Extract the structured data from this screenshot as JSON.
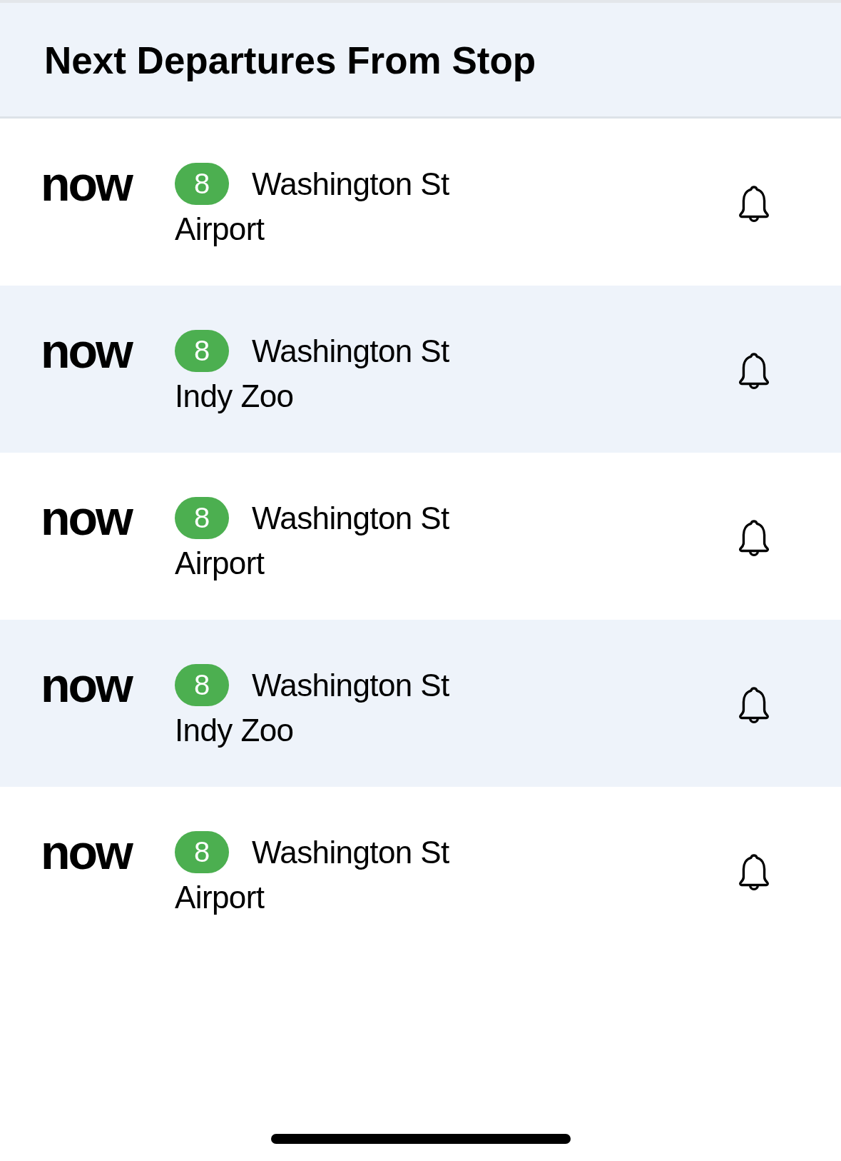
{
  "header": {
    "title": "Next Departures From Stop"
  },
  "departures": [
    {
      "time": "now",
      "route": "8",
      "street": "Washington St",
      "destination": "Airport"
    },
    {
      "time": "now",
      "route": "8",
      "street": "Washington St",
      "destination": "Indy Zoo"
    },
    {
      "time": "now",
      "route": "8",
      "street": "Washington St",
      "destination": "Airport"
    },
    {
      "time": "now",
      "route": "8",
      "street": "Washington St",
      "destination": "Indy Zoo"
    },
    {
      "time": "now",
      "route": "8",
      "street": "Washington St",
      "destination": "Airport"
    }
  ]
}
